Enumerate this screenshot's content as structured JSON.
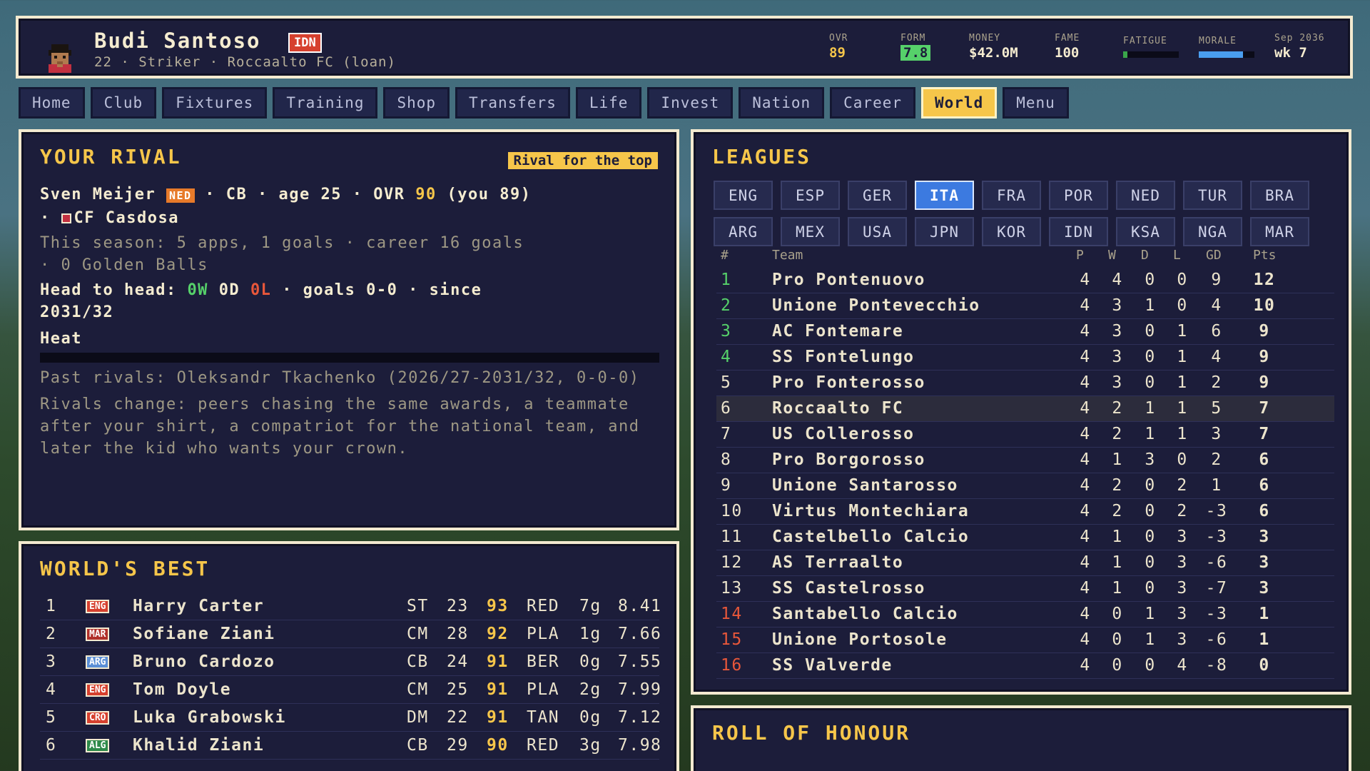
{
  "header": {
    "name": "Budi Santoso",
    "nation": "IDN",
    "subtitle": "22 · Striker · Roccaalto FC (loan)",
    "stats": {
      "ovr_label": "OVR",
      "ovr": "89",
      "form_label": "FORM",
      "form": "7.8",
      "money_label": "MONEY",
      "money": "$42.0M",
      "fame_label": "FAME",
      "fame": "100",
      "fatigue_label": "FATIGUE",
      "fatigue_level": 0.08,
      "morale_label": "MORALE",
      "morale_level": 0.8,
      "date": "Sep 2036",
      "week": "wk 7"
    },
    "colors": {
      "accent": "#f6c64a",
      "form": "#56d16a",
      "fatigue": "#3aa64a",
      "morale": "#4a9ef0"
    }
  },
  "tabs": [
    "Home",
    "Club",
    "Fixtures",
    "Training",
    "Shop",
    "Transfers",
    "Life",
    "Invest",
    "Nation",
    "Career",
    "World",
    "Menu"
  ],
  "active_tab": "World",
  "rival": {
    "title": "YOUR RIVAL",
    "tag": "Rival for the top",
    "name": "Sven Meijer",
    "nation": "NED",
    "position": "CB",
    "age_text": "age 25",
    "ovr_label": "OVR",
    "ovr": "90",
    "you_text": "(you 89)",
    "club": "CF Casdosa",
    "season_line1": "This season: 5 apps, 1 goals · career 16 goals",
    "season_line2": "· 0 Golden Balls",
    "h2h_label": "Head to head:",
    "h2h_w": "0W",
    "h2h_d": "0D",
    "h2h_l": "0L",
    "h2h_rest": "· goals 0-0 · since",
    "h2h_since": "2031/32",
    "heat_label": "Heat",
    "heat_level": 0.0,
    "past": "Past rivals: Oleksandr Tkachenko (2026/27-2031/32, 0-0-0)",
    "note": "Rivals change: peers chasing the same awards, a teammate after your shirt, a compatriot for the national team, and later the kid who wants your crown."
  },
  "worlds_best": {
    "title": "WORLD'S BEST",
    "players": [
      {
        "rank": "1",
        "nation": "ENG",
        "nation_color": "#d6402e",
        "name": "Harry Carter",
        "pos": "ST",
        "age": "23",
        "ovr": "93",
        "club": "RED",
        "goals": "7g",
        "rating": "8.41"
      },
      {
        "rank": "2",
        "nation": "MAR",
        "nation_color": "#b0302a",
        "name": "Sofiane Ziani",
        "pos": "CM",
        "age": "28",
        "ovr": "92",
        "club": "PLA",
        "goals": "1g",
        "rating": "7.66"
      },
      {
        "rank": "3",
        "nation": "ARG",
        "nation_color": "#5b8fd6",
        "name": "Bruno Cardozo",
        "pos": "CB",
        "age": "24",
        "ovr": "91",
        "club": "BER",
        "goals": "0g",
        "rating": "7.55"
      },
      {
        "rank": "4",
        "nation": "ENG",
        "nation_color": "#d6402e",
        "name": "Tom Doyle",
        "pos": "CM",
        "age": "25",
        "ovr": "91",
        "club": "PLA",
        "goals": "2g",
        "rating": "7.99"
      },
      {
        "rank": "5",
        "nation": "CRO",
        "nation_color": "#d6402e",
        "name": "Luka Grabowski",
        "pos": "DM",
        "age": "22",
        "ovr": "91",
        "club": "TAN",
        "goals": "0g",
        "rating": "7.12"
      },
      {
        "rank": "6",
        "nation": "ALG",
        "nation_color": "#2e8a4a",
        "name": "Khalid Ziani",
        "pos": "CB",
        "age": "29",
        "ovr": "90",
        "club": "RED",
        "goals": "3g",
        "rating": "7.98"
      }
    ]
  },
  "leagues": {
    "title": "LEAGUES",
    "chips": [
      "ENG",
      "ESP",
      "GER",
      "ITA",
      "FRA",
      "POR",
      "NED",
      "TUR",
      "BRA",
      "ARG",
      "MEX",
      "USA",
      "JPN",
      "KOR",
      "IDN",
      "KSA",
      "NGA",
      "MAR"
    ],
    "active": "ITA",
    "columns": [
      "#",
      "Team",
      "P",
      "W",
      "D",
      "L",
      "GD",
      "Pts"
    ],
    "rows": [
      {
        "rank": "1",
        "team": "Pro Pontenuovo",
        "p": "4",
        "w": "4",
        "d": "0",
        "l": "0",
        "gd": "9",
        "pts": "12",
        "zone": "promo"
      },
      {
        "rank": "2",
        "team": "Unione Pontevecchio",
        "p": "4",
        "w": "3",
        "d": "1",
        "l": "0",
        "gd": "4",
        "pts": "10",
        "zone": "promo"
      },
      {
        "rank": "3",
        "team": "AC Fontemare",
        "p": "4",
        "w": "3",
        "d": "0",
        "l": "1",
        "gd": "6",
        "pts": "9",
        "zone": "promo"
      },
      {
        "rank": "4",
        "team": "SS Fontelungo",
        "p": "4",
        "w": "3",
        "d": "0",
        "l": "1",
        "gd": "4",
        "pts": "9",
        "zone": "promo"
      },
      {
        "rank": "5",
        "team": "Pro Fonterosso",
        "p": "4",
        "w": "3",
        "d": "0",
        "l": "1",
        "gd": "2",
        "pts": "9",
        "zone": ""
      },
      {
        "rank": "6",
        "team": "Roccaalto FC",
        "p": "4",
        "w": "2",
        "d": "1",
        "l": "1",
        "gd": "5",
        "pts": "7",
        "zone": "own"
      },
      {
        "rank": "7",
        "team": "US Collerosso",
        "p": "4",
        "w": "2",
        "d": "1",
        "l": "1",
        "gd": "3",
        "pts": "7",
        "zone": ""
      },
      {
        "rank": "8",
        "team": "Pro Borgorosso",
        "p": "4",
        "w": "1",
        "d": "3",
        "l": "0",
        "gd": "2",
        "pts": "6",
        "zone": ""
      },
      {
        "rank": "9",
        "team": "Unione Santarosso",
        "p": "4",
        "w": "2",
        "d": "0",
        "l": "2",
        "gd": "1",
        "pts": "6",
        "zone": ""
      },
      {
        "rank": "10",
        "team": "Virtus Montechiara",
        "p": "4",
        "w": "2",
        "d": "0",
        "l": "2",
        "gd": "-3",
        "pts": "6",
        "zone": ""
      },
      {
        "rank": "11",
        "team": "Castelbello Calcio",
        "p": "4",
        "w": "1",
        "d": "0",
        "l": "3",
        "gd": "-3",
        "pts": "3",
        "zone": ""
      },
      {
        "rank": "12",
        "team": "AS Terraalto",
        "p": "4",
        "w": "1",
        "d": "0",
        "l": "3",
        "gd": "-6",
        "pts": "3",
        "zone": ""
      },
      {
        "rank": "13",
        "team": "SS Castelrosso",
        "p": "4",
        "w": "1",
        "d": "0",
        "l": "3",
        "gd": "-7",
        "pts": "3",
        "zone": ""
      },
      {
        "rank": "14",
        "team": "Santabello Calcio",
        "p": "4",
        "w": "0",
        "d": "1",
        "l": "3",
        "gd": "-3",
        "pts": "1",
        "zone": "releg"
      },
      {
        "rank": "15",
        "team": "Unione Portosole",
        "p": "4",
        "w": "0",
        "d": "1",
        "l": "3",
        "gd": "-6",
        "pts": "1",
        "zone": "releg"
      },
      {
        "rank": "16",
        "team": "SS Valverde",
        "p": "4",
        "w": "0",
        "d": "0",
        "l": "4",
        "gd": "-8",
        "pts": "0",
        "zone": "releg"
      }
    ],
    "colors": {
      "promo": "#56d16a",
      "releg": "#e8573a",
      "default": "#ece4cc"
    }
  },
  "honour": {
    "title": "ROLL OF HONOUR"
  }
}
